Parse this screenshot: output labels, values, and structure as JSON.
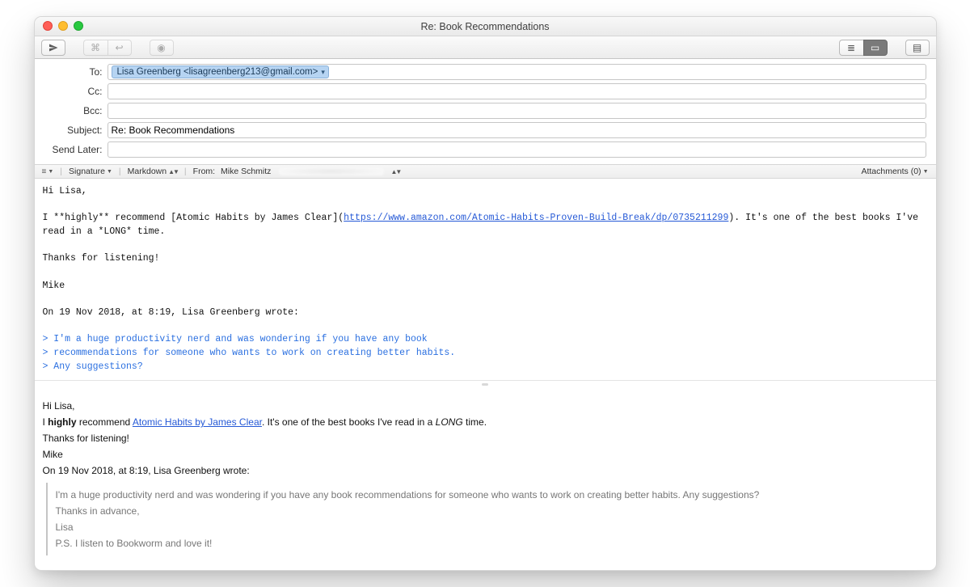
{
  "window": {
    "title": "Re: Book Recommendations"
  },
  "headers": {
    "to_label": "To:",
    "to_token": "Lisa Greenberg <lisagreenberg213@gmail.com>",
    "cc_label": "Cc:",
    "bcc_label": "Bcc:",
    "subject_label": "Subject:",
    "subject_value": "Re: Book Recommendations",
    "sendlater_label": "Send Later:"
  },
  "optbar": {
    "signature": "Signature",
    "format": "Markdown",
    "from_label": "From:",
    "from_value": "Mike Schmitz",
    "attachments": "Attachments (0)"
  },
  "md": {
    "line1": "Hi Lisa,",
    "line2a": "I **highly** recommend [Atomic Habits by James Clear](",
    "line2link": "https://www.amazon.com/Atomic-Habits-Proven-Build-Break/dp/0735211299",
    "line2b": "). It's one of the best books I've read in a *LONG* time.",
    "line3": "Thanks for listening!",
    "line4": "Mike",
    "line5": "On 19 Nov 2018, at 8:19, Lisa Greenberg wrote:",
    "q1": "> I'm a huge productivity nerd and was wondering if you have any book",
    "q2": "> recommendations for someone who wants to work on creating better habits.",
    "q3": "> Any suggestions?"
  },
  "preview": {
    "greeting": "Hi Lisa,",
    "rec_prefix": "I ",
    "rec_bold": "highly",
    "rec_mid": " recommend ",
    "rec_link": "Atomic Habits by James Clear",
    "rec_after": ". It's one of the best books I've read in a ",
    "rec_ital": "LONG",
    "rec_end": " time.",
    "thanks": "Thanks for listening!",
    "sig": "Mike",
    "replyhdr": "On 19 Nov 2018, at 8:19, Lisa Greenberg wrote:",
    "bq1": "I'm a huge productivity nerd and was wondering if you have any book recommendations for someone who wants to work on creating better habits. Any suggestions?",
    "bq2": "Thanks in advance,",
    "bq3": "Lisa",
    "bq4": "P.S. I listen to Bookworm and love it!"
  }
}
